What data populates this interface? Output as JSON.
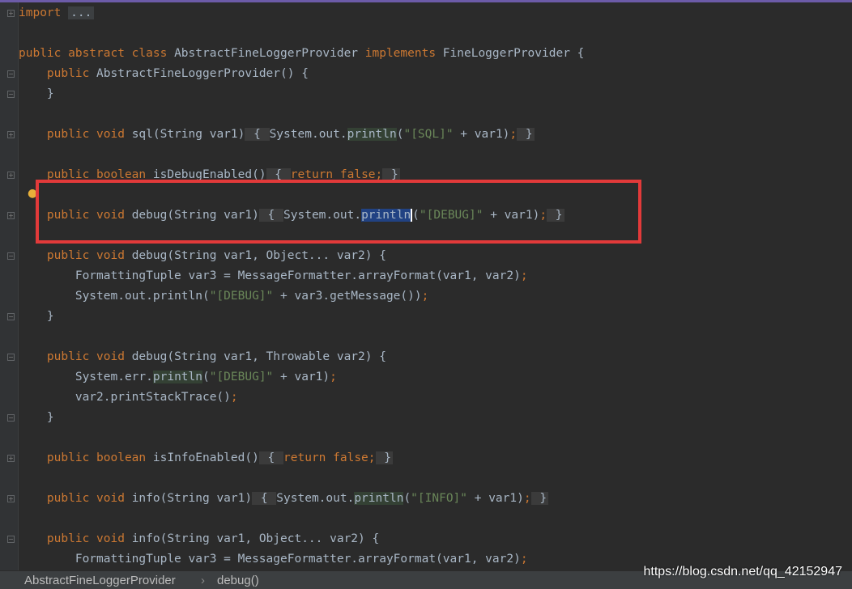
{
  "editor": {
    "lines": [
      [
        {
          "t": "import",
          "c": "kw"
        },
        {
          "t": " "
        },
        {
          "t": "...",
          "c": "fold-box"
        }
      ],
      [],
      [
        {
          "t": "public abstract class ",
          "c": "kw"
        },
        {
          "t": "AbstractFineLoggerProvider "
        },
        {
          "t": "implements ",
          "c": "kw"
        },
        {
          "t": "FineLoggerProvider {"
        }
      ],
      [
        {
          "t": "    "
        },
        {
          "t": "public ",
          "c": "kw"
        },
        {
          "t": "AbstractFineLoggerProvider() {"
        }
      ],
      [
        {
          "t": "    }"
        }
      ],
      [],
      [
        {
          "t": "    "
        },
        {
          "t": "public void ",
          "c": "kw"
        },
        {
          "t": "sql(String var1)"
        },
        {
          "t": " { ",
          "c": "fold-brace"
        },
        {
          "t": "System."
        },
        {
          "t": "out",
          "c": "plain"
        },
        {
          "t": "."
        },
        {
          "t": "println",
          "c": "hl-green"
        },
        {
          "t": "("
        },
        {
          "t": "\"[SQL]\"",
          "c": "str"
        },
        {
          "t": " + var1)"
        },
        {
          "t": ";",
          "c": "kw"
        },
        {
          "t": " }",
          "c": "fold-brace"
        }
      ],
      [],
      [
        {
          "t": "    "
        },
        {
          "t": "public boolean ",
          "c": "kw"
        },
        {
          "t": "isDebugEnabled()"
        },
        {
          "t": " { ",
          "c": "fold-brace"
        },
        {
          "t": "return false",
          "c": "kw"
        },
        {
          "t": ";",
          "c": "kw"
        },
        {
          "t": " }",
          "c": "fold-brace"
        }
      ],
      [],
      [
        {
          "t": "    "
        },
        {
          "t": "public void ",
          "c": "kw"
        },
        {
          "t": "debug(String var1)"
        },
        {
          "t": " { ",
          "c": "fold-brace"
        },
        {
          "t": "System.out."
        },
        {
          "t": "println",
          "c": "hl-sel"
        },
        {
          "t": "(",
          "c": "caret"
        },
        {
          "t": "\"[DEBUG]\"",
          "c": "str"
        },
        {
          "t": " + var1)"
        },
        {
          "t": ";",
          "c": "kw"
        },
        {
          "t": " }",
          "c": "fold-brace"
        }
      ],
      [],
      [
        {
          "t": "    "
        },
        {
          "t": "public void ",
          "c": "kw"
        },
        {
          "t": "debug(String var1, Object... var2) {"
        }
      ],
      [
        {
          "t": "        FormattingTuple var3 = MessageFormatter."
        },
        {
          "t": "arrayFormat"
        },
        {
          "t": "(var1, var2)"
        },
        {
          "t": ";",
          "c": "kw"
        }
      ],
      [
        {
          "t": "        System.out.println("
        },
        {
          "t": "\"[DEBUG]\"",
          "c": "str"
        },
        {
          "t": " + var3.getMessage())"
        },
        {
          "t": ";",
          "c": "kw"
        }
      ],
      [
        {
          "t": "    }"
        }
      ],
      [],
      [
        {
          "t": "    "
        },
        {
          "t": "public void ",
          "c": "kw"
        },
        {
          "t": "debug(String var1, Throwable var2) {"
        }
      ],
      [
        {
          "t": "        System.err."
        },
        {
          "t": "println",
          "c": "hl-green"
        },
        {
          "t": "("
        },
        {
          "t": "\"[DEBUG]\"",
          "c": "str"
        },
        {
          "t": " + var1)"
        },
        {
          "t": ";",
          "c": "kw"
        }
      ],
      [
        {
          "t": "        var2.printStackTrace()"
        },
        {
          "t": ";",
          "c": "kw"
        }
      ],
      [
        {
          "t": "    }"
        }
      ],
      [],
      [
        {
          "t": "    "
        },
        {
          "t": "public boolean ",
          "c": "kw"
        },
        {
          "t": "isInfoEnabled()"
        },
        {
          "t": " { ",
          "c": "fold-brace"
        },
        {
          "t": "return false",
          "c": "kw"
        },
        {
          "t": ";",
          "c": "kw"
        },
        {
          "t": " }",
          "c": "fold-brace"
        }
      ],
      [],
      [
        {
          "t": "    "
        },
        {
          "t": "public void ",
          "c": "kw"
        },
        {
          "t": "info(String var1)"
        },
        {
          "t": " { ",
          "c": "fold-brace"
        },
        {
          "t": "System.out."
        },
        {
          "t": "println",
          "c": "hl-green"
        },
        {
          "t": "("
        },
        {
          "t": "\"[INFO]\"",
          "c": "str"
        },
        {
          "t": " + var1)"
        },
        {
          "t": ";",
          "c": "kw"
        },
        {
          "t": " }",
          "c": "fold-brace"
        }
      ],
      [],
      [
        {
          "t": "    "
        },
        {
          "t": "public void ",
          "c": "kw"
        },
        {
          "t": "info(String var1, Object... var2) {"
        }
      ],
      [
        {
          "t": "        FormattingTuple var3 = MessageFormatter.arrayFormat(var1, var2)"
        },
        {
          "t": ";",
          "c": "kw"
        }
      ]
    ],
    "fold_markers": [
      {
        "line": 0,
        "kind": "plus"
      },
      {
        "line": 3,
        "kind": "minus"
      },
      {
        "line": 4,
        "kind": "minus"
      },
      {
        "line": 6,
        "kind": "plus"
      },
      {
        "line": 8,
        "kind": "plus"
      },
      {
        "line": 10,
        "kind": "plus"
      },
      {
        "line": 12,
        "kind": "minus"
      },
      {
        "line": 15,
        "kind": "minus"
      },
      {
        "line": 17,
        "kind": "minus"
      },
      {
        "line": 20,
        "kind": "minus"
      },
      {
        "line": 22,
        "kind": "plus"
      },
      {
        "line": 24,
        "kind": "plus"
      },
      {
        "line": 26,
        "kind": "minus"
      }
    ]
  },
  "breadcrumb": {
    "class_name": "AbstractFineLoggerProvider",
    "separator": "›",
    "method_name": "debug()"
  },
  "watermark": "https://blog.csdn.net/qq_42152947",
  "colors": {
    "background": "#2b2b2b",
    "keyword": "#cc7832",
    "string": "#6a8759",
    "text": "#a9b7c6",
    "selection": "#214283",
    "annotation_box": "#e23a3a"
  },
  "icons": {
    "intention_bulb": "lightbulb-icon",
    "fold": "fold-toggle-icon"
  }
}
